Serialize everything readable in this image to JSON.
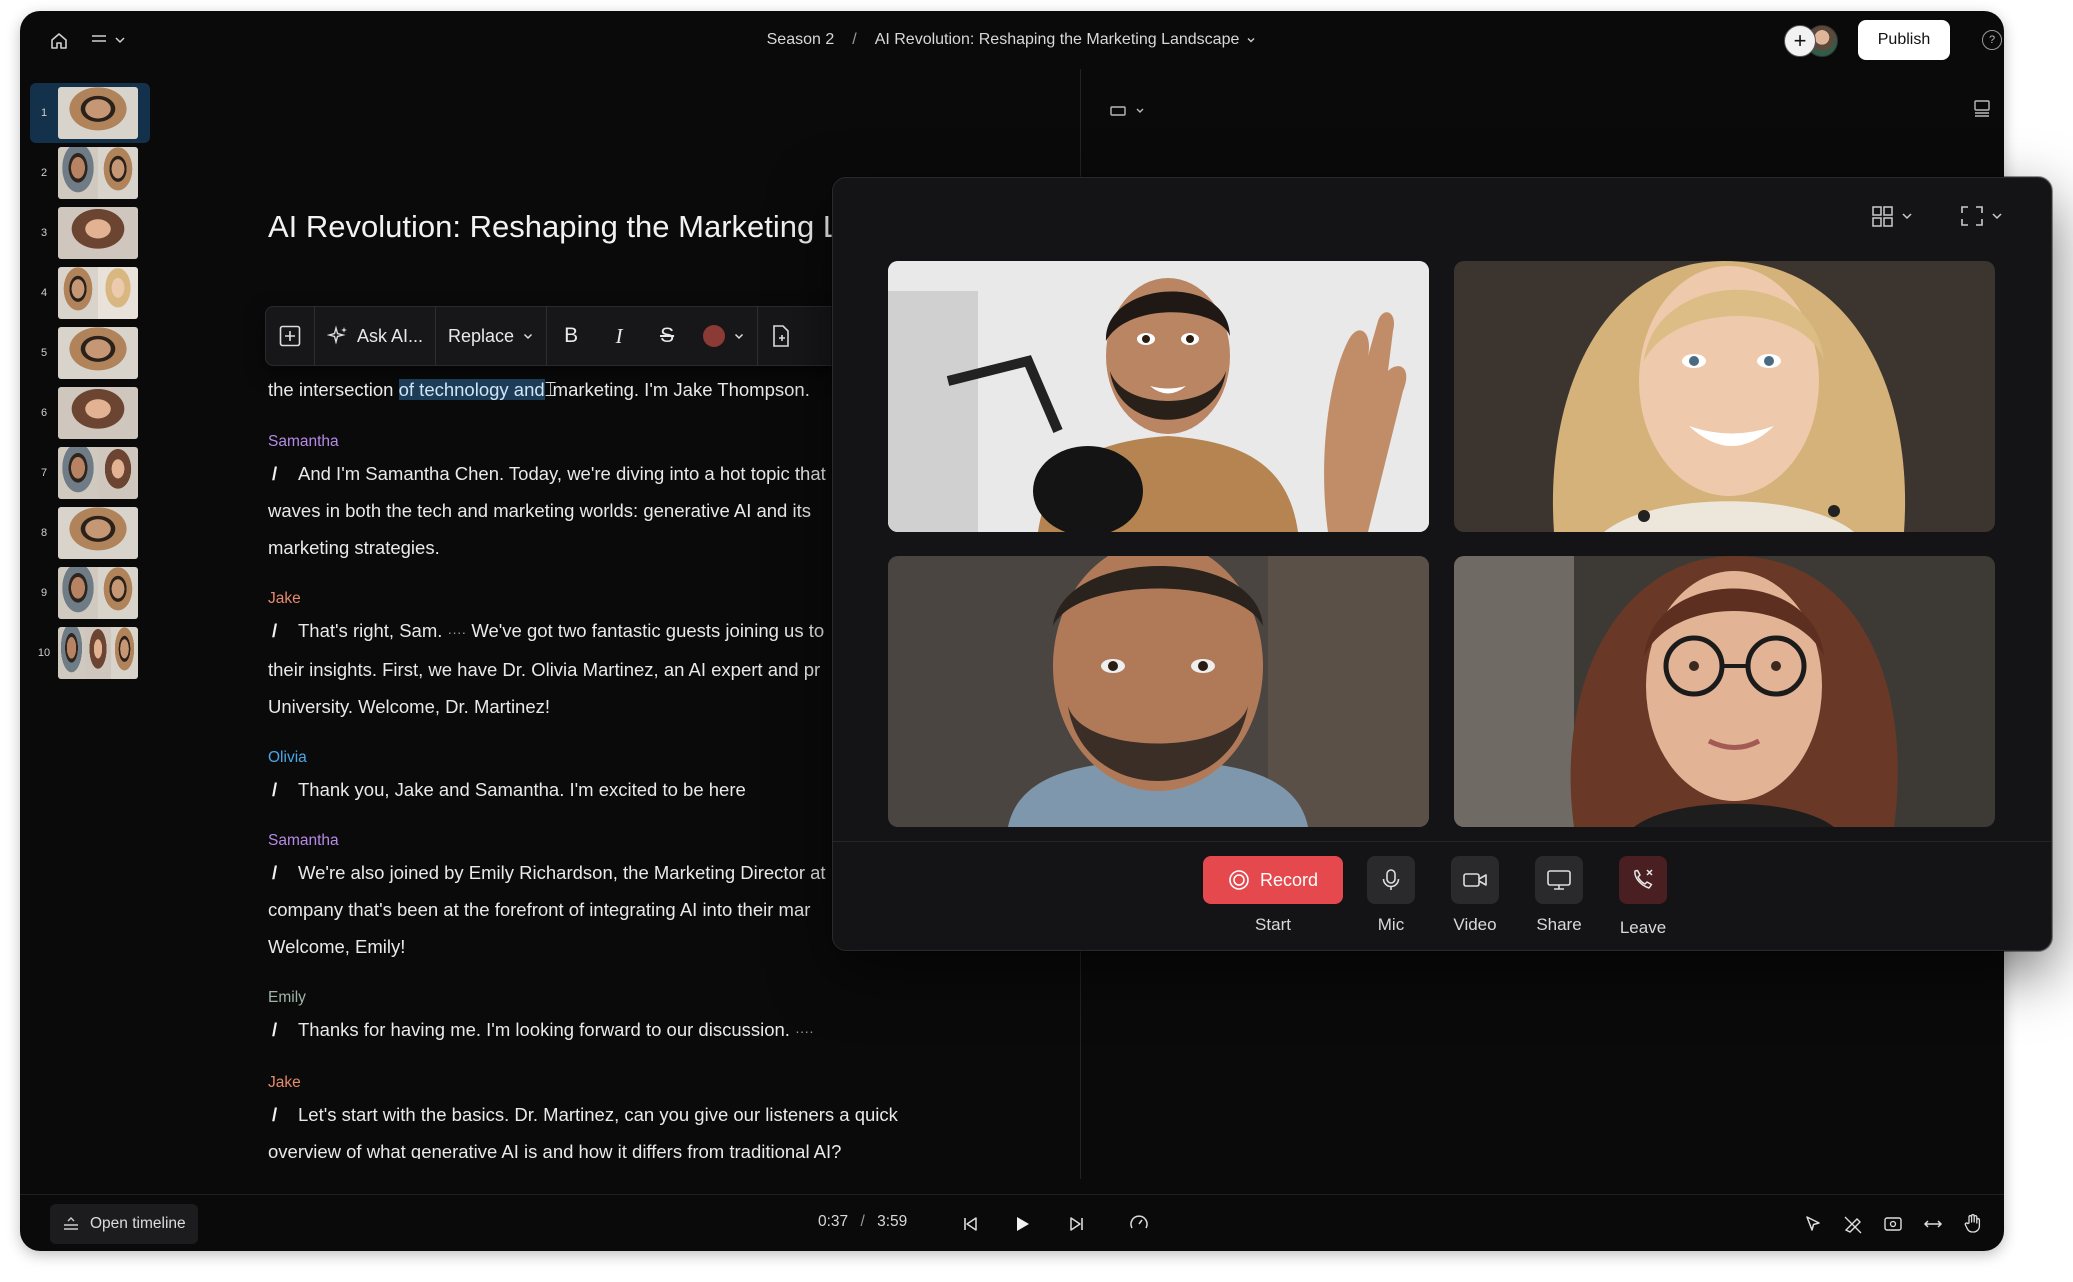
{
  "topbar": {
    "breadcrumb_season": "Season 2",
    "breadcrumb_sep": "/",
    "breadcrumb_title": "AI Revolution: Reshaping the Marketing Landscape",
    "publish_label": "Publish",
    "help_label": "?"
  },
  "slides": [
    {
      "num": "1",
      "active": true
    },
    {
      "num": "2"
    },
    {
      "num": "3"
    },
    {
      "num": "4"
    },
    {
      "num": "5"
    },
    {
      "num": "6"
    },
    {
      "num": "7"
    },
    {
      "num": "8"
    },
    {
      "num": "9"
    },
    {
      "num": "10"
    }
  ],
  "editor": {
    "title": "AI Revolution: Reshaping the Marketing Landscape",
    "toolbar": {
      "ask_ai": "Ask AI...",
      "replace": "Replace",
      "bold": "B",
      "italic": "I",
      "strike": "S",
      "text_color": "#8c3a35"
    }
  },
  "transcript": {
    "line0_pre": "the intersection ",
    "line0_hl": "of technology and",
    "line0_post": "marketing. I'm Jake Thompson.",
    "blocks": [
      {
        "speaker": "Samantha",
        "lines": [
          "And I'm Samantha Chen. Today, we're diving into a hot topic that",
          "waves in both the tech and marketing worlds: generative AI and its",
          "marketing strategies."
        ]
      },
      {
        "speaker": "Jake",
        "lines": [
          "That's right, Sam.",
          "We've got two fantastic guests joining us to",
          "their insights. First, we have Dr. Olivia Martinez, an AI expert and pr",
          "University. Welcome, Dr. Martinez!"
        ]
      },
      {
        "speaker": "Olivia",
        "lines": [
          "Thank you, Jake and Samantha. I'm excited to be here"
        ]
      },
      {
        "speaker": "Samantha",
        "lines": [
          "We're also joined by Emily Richardson, the Marketing Director at",
          "company that's been at the forefront of integrating AI into their mar",
          "Welcome, Emily!"
        ]
      },
      {
        "speaker": "Emily",
        "lines": [
          "Thanks for having me. I'm looking forward to our discussion."
        ]
      },
      {
        "speaker": "Jake",
        "lines": [
          "Let's start with the basics. Dr. Martinez, can you give our listeners a quick",
          "overview of what generative AI is and how it differs from traditional AI?"
        ]
      }
    ]
  },
  "call": {
    "record_label": "Record",
    "start_label": "Start",
    "mic_label": "Mic",
    "video_label": "Video",
    "share_label": "Share",
    "leave_label": "Leave",
    "record_color": "#e5484d"
  },
  "bottombar": {
    "open_timeline": "Open timeline",
    "time_current": "0:37",
    "time_sep": "/",
    "time_total": "3:59"
  }
}
